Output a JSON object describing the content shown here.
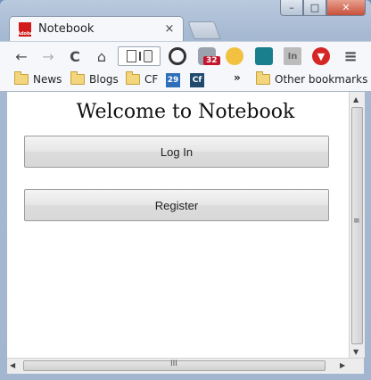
{
  "browser": {
    "tab_title": "Notebook",
    "tab_favicon_text": "Adobe",
    "tab_close": "×",
    "window_controls": {
      "minimize": "–",
      "maximize": "□",
      "close": "✕"
    }
  },
  "toolbar": {
    "back": "←",
    "forward": "→",
    "reload": "C",
    "home": "⌂",
    "extension_badge": "32",
    "menu": "≡"
  },
  "bookmarks": {
    "items": [
      "News",
      "Blogs",
      "CF"
    ],
    "cal_label": "29",
    "cf_label": "Cf",
    "overflow": "»",
    "other": "Other bookmarks"
  },
  "page": {
    "heading": "Welcome to Notebook",
    "login_label": "Log In",
    "register_label": "Register"
  }
}
